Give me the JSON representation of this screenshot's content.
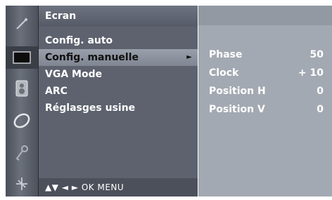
{
  "menu": {
    "title": "Ecran",
    "items": [
      {
        "label": "Config. auto",
        "selected": false
      },
      {
        "label": "Config. manuelle",
        "selected": true,
        "arrow": "►"
      },
      {
        "label": "VGA Mode",
        "selected": false
      },
      {
        "label": "ARC",
        "selected": false
      },
      {
        "label": "Réglasges usine",
        "selected": false
      }
    ],
    "footer": "▲▼  ◄ ►  OK  MENU"
  },
  "submenu": {
    "rows": [
      {
        "label": "Phase",
        "value": "50"
      },
      {
        "label": "Clock",
        "value": "+ 10"
      },
      {
        "label": "Position H",
        "value": "0"
      },
      {
        "label": "Position V",
        "value": "0"
      }
    ]
  },
  "icons": [
    {
      "name": "adjust-icon"
    },
    {
      "name": "screen-icon",
      "active": true
    },
    {
      "name": "speaker-icon"
    },
    {
      "name": "clock-icon"
    },
    {
      "name": "key-icon"
    },
    {
      "name": "option-icon"
    }
  ],
  "colors": {
    "menu_bg": "#5d626e",
    "submenu_bg": "#a3a9b2",
    "selected_bg": "#8d939e"
  }
}
